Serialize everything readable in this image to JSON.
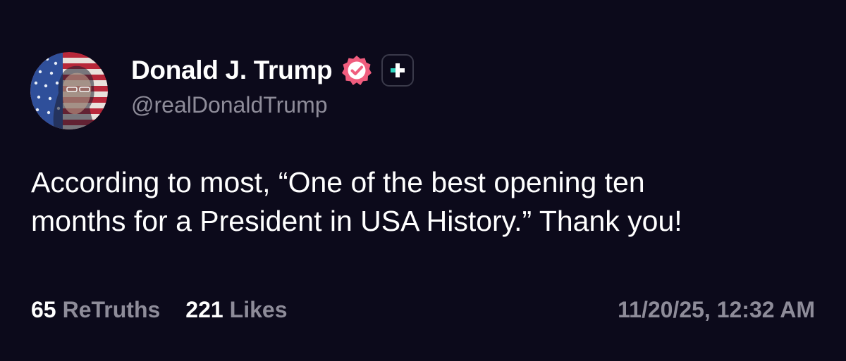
{
  "author": {
    "display_name": "Donald J. Trump",
    "handle": "@realDonaldTrump",
    "avatar_icon": "profile-avatar-flag-portrait",
    "verified_icon": "verified-check-icon",
    "verified_color": "#f05d7e",
    "truth_plus_icon": "truth-plus-icon",
    "truth_plus_color": "#2dd4bf"
  },
  "post": {
    "text_lines": [
      "According to most, “One of the best opening ten",
      "months for a President in USA History.” Thank you!"
    ]
  },
  "stats": {
    "retruths_count": "65",
    "retruths_label": "ReTruths",
    "likes_count": "221",
    "likes_label": "Likes",
    "timestamp": "11/20/25, 12:32 AM"
  },
  "colors": {
    "background": "#0c0a1b",
    "text": "#ffffff",
    "muted": "#8e8c99"
  }
}
